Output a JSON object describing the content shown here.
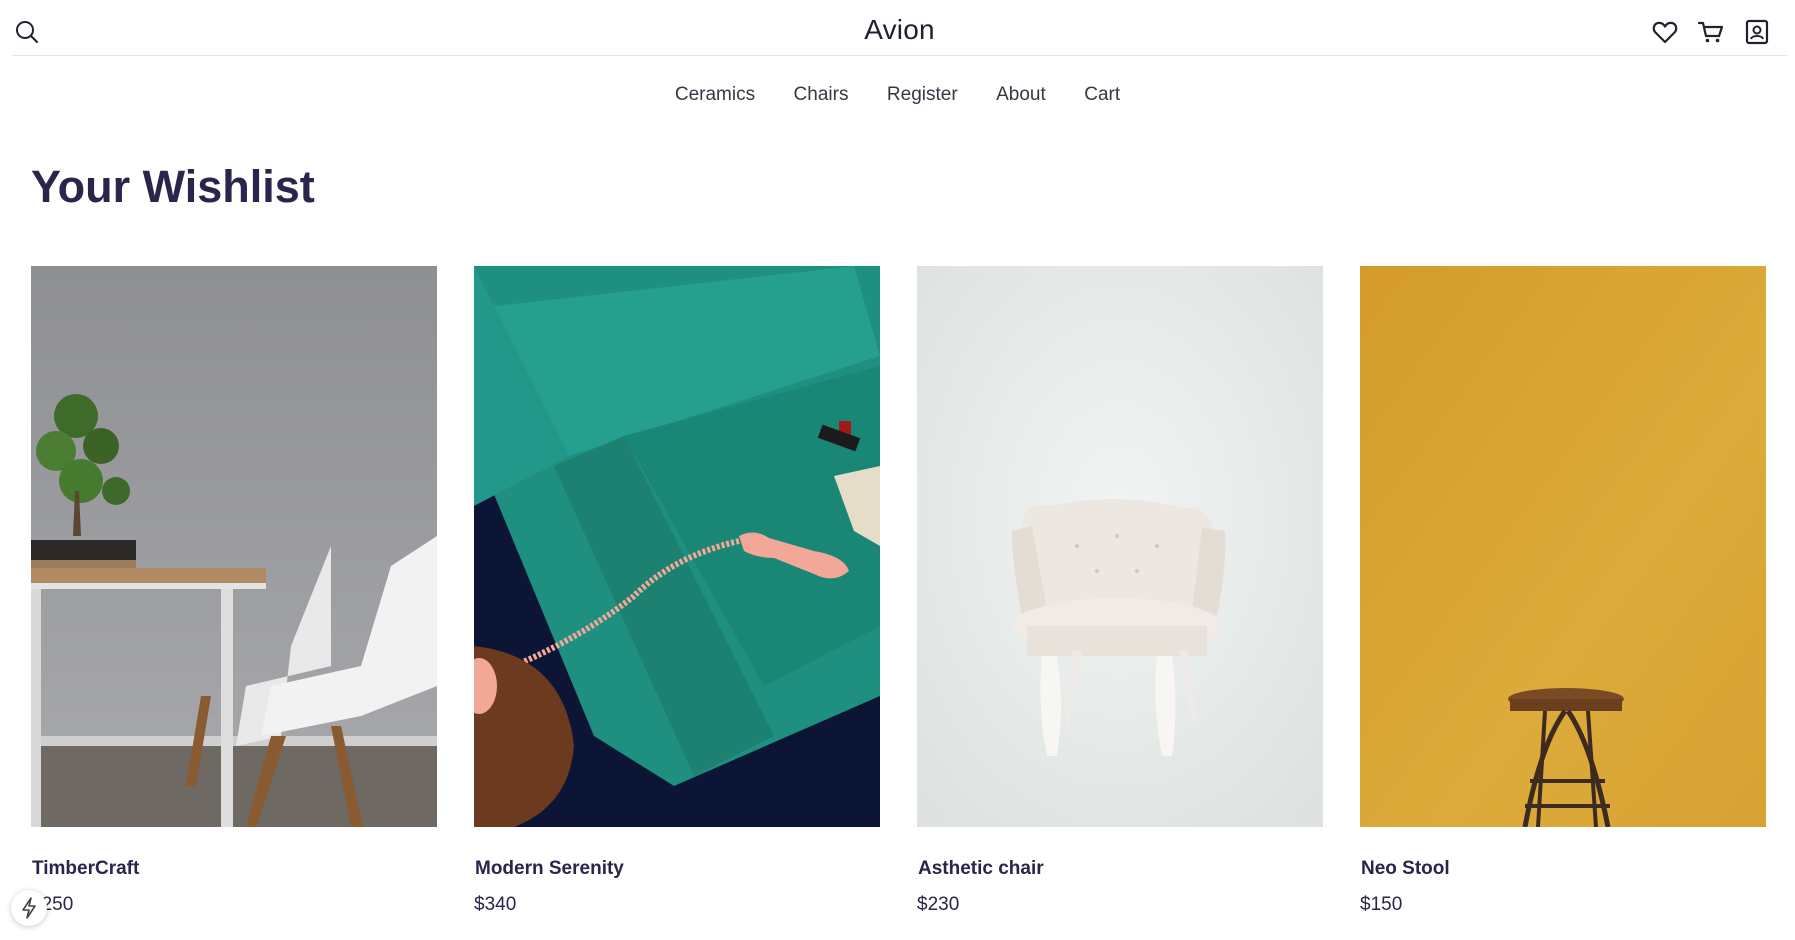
{
  "header": {
    "logo": "Avion",
    "icons": [
      "search-icon",
      "heart-icon",
      "cart-icon",
      "user-icon"
    ]
  },
  "nav": {
    "items": [
      {
        "label": "Ceramics"
      },
      {
        "label": "Chairs"
      },
      {
        "label": "Register"
      },
      {
        "label": "About"
      },
      {
        "label": "Cart"
      }
    ]
  },
  "page": {
    "title": "Your Wishlist"
  },
  "products": [
    {
      "name": "TimberCraft",
      "price": "$250",
      "image": "dining-table-chairs-photo"
    },
    {
      "name": "Modern Serenity",
      "price": "$340",
      "image": "teal-sofa-telephone-photo"
    },
    {
      "name": "Asthetic chair",
      "price": "$230",
      "image": "white-armchair-photo"
    },
    {
      "name": "Neo Stool",
      "price": "$150",
      "image": "wooden-stool-yellow-photo"
    }
  ],
  "colors": {
    "brand_text": "#2a254b",
    "yellow_bg": "#d9a42e",
    "teal_sofa": "#1f8f7f",
    "navy_bg": "#0c1535"
  },
  "floating_badge": {
    "icon": "bolt-icon"
  }
}
